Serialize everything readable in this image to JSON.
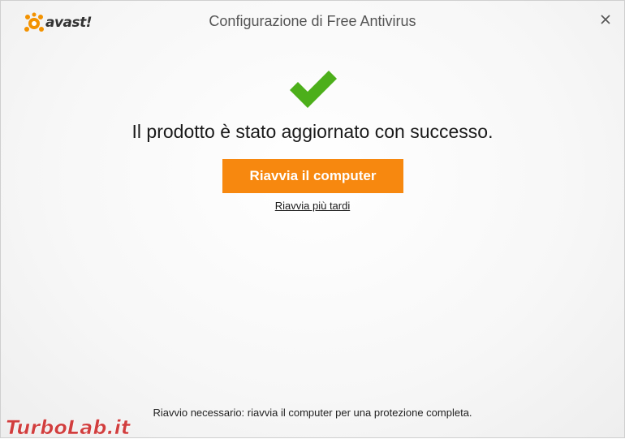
{
  "window": {
    "title": "Configurazione di Free Antivirus",
    "logo_text": "avast!",
    "close_icon": "close-icon"
  },
  "main": {
    "success_icon": "checkmark-icon",
    "headline": "Il prodotto è stato aggiornato con successo.",
    "restart_button": "Riavvia il computer",
    "later_link": "Riavvia più tardi"
  },
  "footer": {
    "note": "Riavvio necessario: riavvia il computer per una protezione completa."
  },
  "watermark": {
    "text": "TurboLab.it"
  },
  "colors": {
    "accent": "#f7880f",
    "success": "#4caf1a",
    "logo_orange": "#f39200"
  }
}
